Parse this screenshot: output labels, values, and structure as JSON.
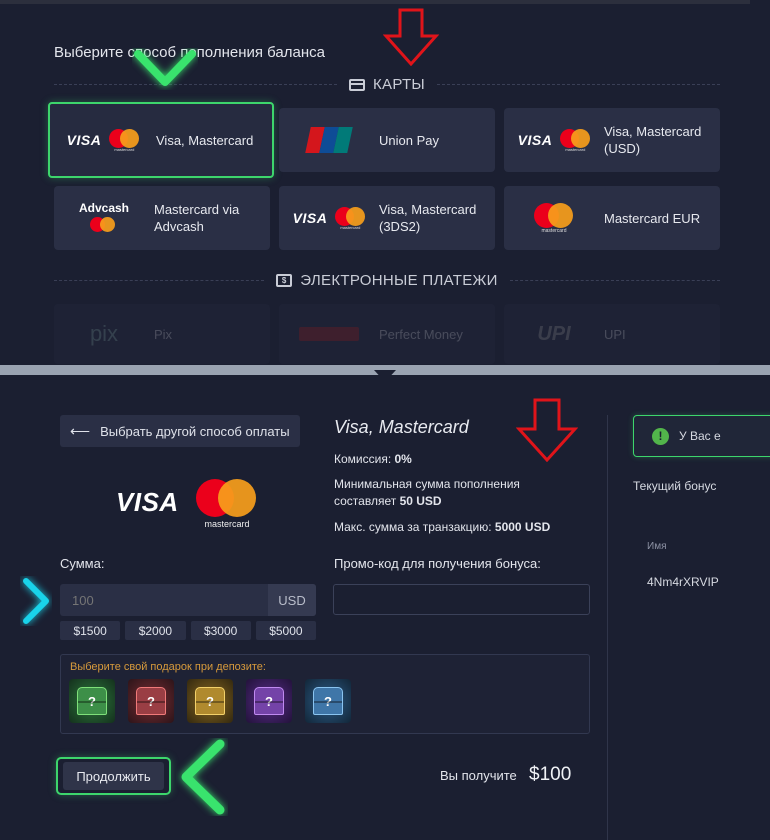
{
  "top": {
    "heading": "Выберите способ пополнения баланса",
    "cards_section": "КАРТЫ",
    "epay_section": "ЭЛЕКТРОННЫЕ ПЛАТЕЖИ",
    "methods": [
      {
        "label": "Visa, Mastercard",
        "logo": "visa-mastercard",
        "selected": true
      },
      {
        "label": "Union Pay",
        "logo": "unionpay"
      },
      {
        "label": "Visa, Mastercard (USD)",
        "logo": "visa-mastercard"
      },
      {
        "label": "Mastercard via Advcash",
        "logo": "advcash-mastercard"
      },
      {
        "label": "Visa, Mastercard (3DS2)",
        "logo": "visa-mastercard"
      },
      {
        "label": "Mastercard EUR",
        "logo": "mastercard"
      }
    ],
    "epay_methods": [
      {
        "label": "Pix",
        "logo_text": "pix"
      },
      {
        "label": "Perfect Money"
      },
      {
        "label": "UPI",
        "logo_text": "UPI"
      }
    ],
    "logo_text": {
      "visa": "VISA",
      "mastercard": "mastercard",
      "unionpay_1": "UnionPay",
      "unionpay_2": "银联",
      "advcash": "Advcash"
    }
  },
  "left": {
    "back_button": "Выбрать другой способ оплаты",
    "sum_label": "Сумма:",
    "sum_placeholder": "100",
    "currency": "USD",
    "presets": [
      "$1500",
      "$2000",
      "$3000",
      "$5000"
    ],
    "gift_title": "Выберите свой подарок при депозите:",
    "gift_chests": [
      "green",
      "red",
      "gold",
      "purple",
      "blue"
    ],
    "continue_button": "Продолжить"
  },
  "center": {
    "method_title": "Visa, Mastercard",
    "commission_label": "Комиссия: ",
    "commission_value": "0%",
    "min_label_1": "Минимальная сумма пополнения",
    "min_label_2": "составляет ",
    "min_value": "50 USD",
    "max_label": "Макс. сумма за транзакцию: ",
    "max_value": "5000 USD",
    "promo_label": "Промо-код для получения бонуса:",
    "promo_value": "",
    "receive_label": "Вы получите",
    "receive_value": "$100"
  },
  "right": {
    "notice": "У Вас е",
    "current_bonus": "Текущий бонус",
    "col_name": "Имя",
    "row_value": "4Nm4rXRVIP"
  },
  "colors": {
    "background": "#1b1f31",
    "card": "#2a2f45",
    "accent_green": "#3dd66c",
    "arrow_red": "#e0141a",
    "arrow_cyan": "#19d3ea",
    "gift_title": "#d79a3c"
  }
}
